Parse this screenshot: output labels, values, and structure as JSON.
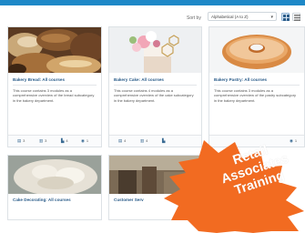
{
  "toolbar": {
    "sort_label": "Sort by",
    "sort_value": "Alphabetical (A to Z)"
  },
  "cards": [
    {
      "title": "Bakery Bread: All courses",
      "description": "This course contains 3 modules as a comprehensive overview of the bread subcategory in the bakery department.",
      "stats": {
        "courses": "3",
        "modules": "3",
        "lessons": "4",
        "views": "1"
      }
    },
    {
      "title": "Bakery Cake: All courses",
      "description": "This course contains 4 modules as a comprehensive overview of the cake subcategory in the bakery department.",
      "stats": {
        "courses": "4",
        "modules": "4",
        "lessons": ""
      }
    },
    {
      "title": "Bakery Pastry: All courses",
      "description": "This course contains 3 modules as a comprehensive overview of the pastry subcategory in the bakery department.",
      "stats": {
        "views": "1"
      }
    }
  ],
  "cards_row2": [
    {
      "title": "Cake Decorating: All courses"
    },
    {
      "title": "Customer Serv"
    }
  ],
  "badge": {
    "line1": "Retail",
    "line2": "Associates",
    "line3": "Training",
    "color": "#f26b21"
  }
}
